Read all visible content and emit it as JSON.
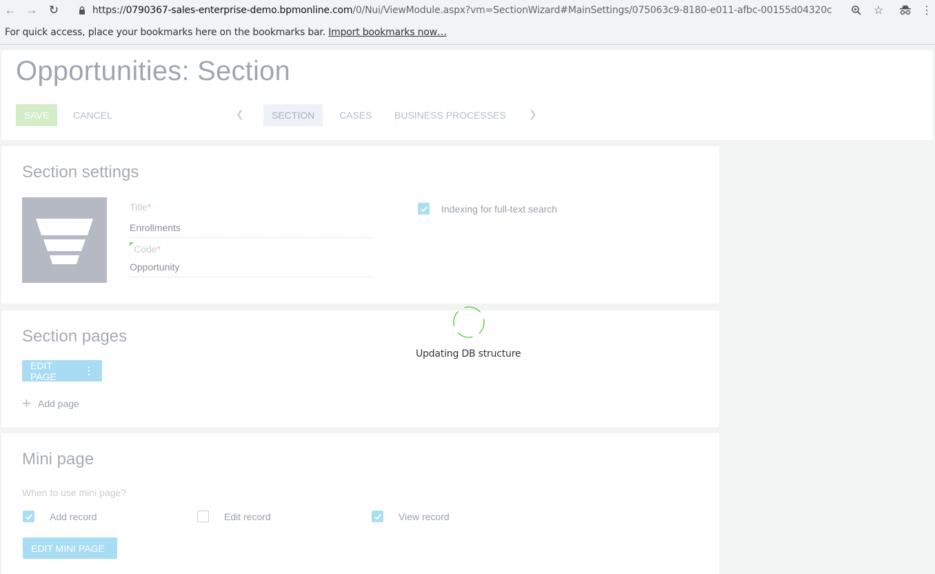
{
  "browser": {
    "url_scheme": "https://",
    "url_host": "0790367-sales-enterprise-demo.bpmonline.com",
    "url_path": "/0/Nui/ViewModule.aspx?vm=SectionWizard#MainSettings/075063c9-8180-e011-afbc-00155d04320c",
    "bookmarks_text": "For quick access, place your bookmarks here on the bookmarks bar.",
    "bookmarks_link": "Import bookmarks now…"
  },
  "header": {
    "title": "Opportunities: Section",
    "save_label": "SAVE",
    "cancel_label": "CANCEL",
    "tabs": [
      {
        "label": "SECTION",
        "active": true
      },
      {
        "label": "CASES",
        "active": false
      },
      {
        "label": "BUSINESS PROCESSES",
        "active": false
      }
    ]
  },
  "section_settings": {
    "heading": "Section settings",
    "title_label": "Title",
    "title_value": "Enrollments",
    "code_label": "Code",
    "code_value": "Opportunity",
    "required_mark": "*",
    "indexing_label": "Indexing for full-text search",
    "indexing_checked": true
  },
  "section_pages": {
    "heading": "Section pages",
    "edit_page_label": "EDIT PAGE",
    "add_page_label": "Add page"
  },
  "mini_page": {
    "heading": "Mini page",
    "question": "When to use mini page?",
    "options": [
      {
        "label": "Add record",
        "checked": true
      },
      {
        "label": "Edit record",
        "checked": false
      },
      {
        "label": "View record",
        "checked": true
      }
    ],
    "edit_mini_label": "EDIT MINI PAGE"
  },
  "loading": {
    "text": "Updating DB structure"
  },
  "colors": {
    "save_green": "#d4ecc7",
    "accent_blue": "#a8dcf2",
    "spinner_green": "#6ccf4f"
  }
}
